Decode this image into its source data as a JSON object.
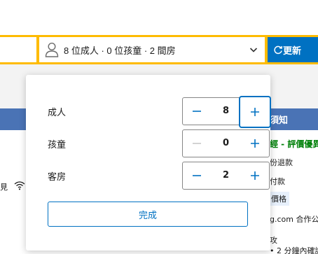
{
  "search": {
    "occupancy_text": "8 位成人 · 0 位孩童 · 2 間房",
    "update_label": "更新"
  },
  "background": {
    "right_heading": "須知",
    "green_line": "經 - 評價優異",
    "line_refund": "份退款",
    "line_pay": "付款",
    "price_badge": "價格",
    "line_partner": "g.com 合作公司",
    "line_more": "攻",
    "line_confirm": "• 2 分鐘內確認",
    "left_snip": "見"
  },
  "popup": {
    "rows": [
      {
        "label": "成人",
        "value": "8",
        "minus_enabled": true,
        "plus_enabled": true
      },
      {
        "label": "孩童",
        "value": "0",
        "minus_enabled": false,
        "plus_enabled": true
      },
      {
        "label": "客房",
        "value": "2",
        "minus_enabled": true,
        "plus_enabled": true
      }
    ],
    "done_label": "完成"
  },
  "colors": {
    "brand_blue": "#0071c2",
    "search_yellow": "#febb02",
    "header_blue": "#4a73b5",
    "disabled_grey": "#c8c8c8"
  },
  "icons": {
    "occupancy": "person-icon",
    "dropdown": "chevron-down-icon",
    "update": "refresh-icon",
    "wifi": "wifi-icon"
  }
}
